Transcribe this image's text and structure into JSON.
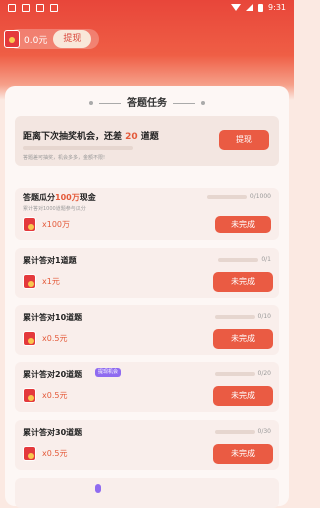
{
  "status_bar": {
    "time": "9:31"
  },
  "balance": {
    "amount": "0.0元",
    "withdraw_label": "提现"
  },
  "section": {
    "title": "答题任务"
  },
  "lottery": {
    "prefix": "距离下次抽奖机会，还差 ",
    "count": "20",
    "suffix": " 道题",
    "note": "答题差可抽奖，机会多多，金额不限!",
    "button_label": "提现"
  },
  "tasks": [
    {
      "title_prefix": "答题瓜分",
      "title_highlight": "100万",
      "title_suffix": "现金",
      "desc": "累计答对1000道题参与瓜分",
      "reward": "x100万",
      "progress": "0/1000",
      "button": "未完成"
    },
    {
      "title": "累计答对1道题",
      "reward": "x1元",
      "progress": "0/1",
      "button": "未完成"
    },
    {
      "title": "累计答对10道题",
      "reward": "x0.5元",
      "progress": "0/10",
      "button": "未完成"
    },
    {
      "title": "累计答对20道题",
      "badge": "提现机会",
      "reward": "x0.5元",
      "progress": "0/20",
      "button": "未完成"
    },
    {
      "title": "累计答对30道题",
      "reward": "x0.5元",
      "progress": "0/30",
      "button": "未完成"
    }
  ],
  "colors": {
    "accent": "#ea5b43",
    "highlight": "#e45a3a",
    "badge": "#8f6bf0"
  }
}
